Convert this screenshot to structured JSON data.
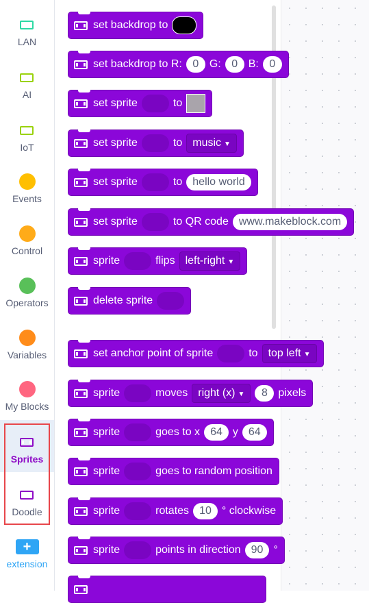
{
  "sidebar": {
    "categories": [
      {
        "label": "LAN",
        "icon": "sprite-icon",
        "color": "#2ed9a4"
      },
      {
        "label": "AI",
        "icon": "sprite-icon",
        "color": "#9ad20c"
      },
      {
        "label": "IoT",
        "icon": "sprite-icon",
        "color": "#9ad20c"
      },
      {
        "label": "Events",
        "icon": "circle-icon",
        "color": "#ffbf00"
      },
      {
        "label": "Control",
        "icon": "circle-icon",
        "color": "#ffab19"
      },
      {
        "label": "Operators",
        "icon": "circle-icon",
        "color": "#59c059"
      },
      {
        "label": "Variables",
        "icon": "circle-icon",
        "color": "#ff8c1a"
      },
      {
        "label": "My Blocks",
        "icon": "circle-icon",
        "color": "#ff6680"
      },
      {
        "label": "Sprites",
        "icon": "sprite-icon",
        "color": "#8f0cc6",
        "selected": true
      },
      {
        "label": "Doodle",
        "icon": "sprite-icon",
        "color": "#8f0cc6"
      }
    ],
    "extension_label": "extension",
    "extension_color": "#2fa5f5"
  },
  "blocks": {
    "b1": {
      "text": "set backdrop to"
    },
    "b2": {
      "text1": "set backdrop to R:",
      "r": "0",
      "g_label": "G:",
      "g": "0",
      "b_label": "B:",
      "b": "0"
    },
    "b3": {
      "text1": "set sprite",
      "text2": "to"
    },
    "b4": {
      "text1": "set sprite",
      "text2": "to",
      "option": "music"
    },
    "b5": {
      "text1": "set sprite",
      "text2": "to",
      "value": "hello world"
    },
    "b6": {
      "text1": "set sprite",
      "text2": "to QR code",
      "value": "www.makeblock.com"
    },
    "b7": {
      "text1": "sprite",
      "text2": "flips",
      "option": "left-right"
    },
    "b8": {
      "text1": "delete sprite"
    },
    "b9": {
      "text1": "set anchor point of sprite",
      "text2": "to",
      "option": "top left"
    },
    "b10": {
      "text1": "sprite",
      "text2": "moves",
      "option": "right (x)",
      "value": "8",
      "text3": "pixels"
    },
    "b11": {
      "text1": "sprite",
      "text2": "goes to x",
      "x": "64",
      "y_label": "y",
      "y": "64"
    },
    "b12": {
      "text1": "sprite",
      "text2": "goes to random position"
    },
    "b13": {
      "text1": "sprite",
      "text2": "rotates",
      "value": "10",
      "text3": "° clockwise"
    },
    "b14": {
      "text1": "sprite",
      "text2": "points in direction",
      "value": "90",
      "text3": "°"
    }
  },
  "colors": {
    "block": "#8b07d9",
    "slot": "#7a05c2",
    "highlight": "#e8464b"
  }
}
